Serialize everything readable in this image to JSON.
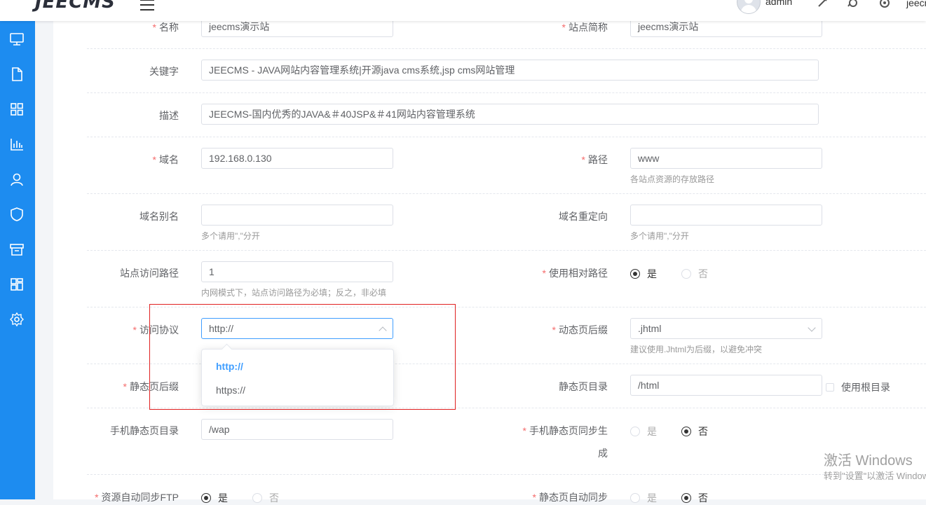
{
  "header": {
    "logo": "JEECMS",
    "user_name": "admin",
    "site_text": "jeecms演示站"
  },
  "sidebar": {
    "items": [
      {
        "icon": "monitor-icon"
      },
      {
        "icon": "document-icon"
      },
      {
        "icon": "grid-icon"
      },
      {
        "icon": "bar-chart-icon"
      },
      {
        "icon": "user-icon"
      },
      {
        "icon": "shield-icon"
      },
      {
        "icon": "archive-icon"
      },
      {
        "icon": "modules-icon"
      },
      {
        "icon": "gear-icon"
      }
    ]
  },
  "form": {
    "name": {
      "label": "名称",
      "value": "jeecms演示站"
    },
    "short_name": {
      "label": "站点简称",
      "value": "jeecms演示站"
    },
    "keywords": {
      "label": "关键字",
      "value": "JEECMS - JAVA网站内容管理系统|开源java cms系统,jsp cms网站管理"
    },
    "description": {
      "label": "描述",
      "value": "JEECMS-国内优秀的JAVA&＃40JSP&＃41网站内容管理系统"
    },
    "domain": {
      "label": "域名",
      "value": "192.168.0.130"
    },
    "path": {
      "label": "路径",
      "value": "www",
      "hint": "各站点资源的存放路径"
    },
    "domain_alias": {
      "label": "域名别名",
      "value": "",
      "hint": "多个请用\",\"分开"
    },
    "domain_redirect": {
      "label": "域名重定向",
      "value": "",
      "hint": "多个请用\",\"分开"
    },
    "site_path": {
      "label": "站点访问路径",
      "value": "1",
      "hint": "内网模式下，站点访问路径为必填；反之，非必填"
    },
    "relative_path": {
      "label": "使用相对路径",
      "yes": "是",
      "no": "否",
      "selected": "是"
    },
    "protocol": {
      "label": "访问协议",
      "value": "http://",
      "options": [
        "http://",
        "https://"
      ],
      "selected": "http://"
    },
    "dynamic_suffix": {
      "label": "动态页后缀",
      "value": ".jhtml",
      "hint": "建议使用.Jhtml为后缀，以避免冲突"
    },
    "static_suffix": {
      "label": "静态页后缀"
    },
    "static_dir": {
      "label": "静态页目录",
      "value": "/html",
      "checkbox_label": "使用根目录"
    },
    "mobile_static_dir": {
      "label": "手机静态页目录",
      "value": "/wap"
    },
    "mobile_static_sync": {
      "label_line1": "手机静态页同步生",
      "label_line2": "成",
      "yes": "是",
      "no": "否",
      "selected": "否"
    },
    "resource_ftp_sync": {
      "label": "资源自动同步FTP",
      "yes": "是",
      "no": "否",
      "selected": "是"
    },
    "static_auto_sync": {
      "label": "静态页自动同步",
      "yes": "是",
      "no": "否",
      "selected": "否"
    }
  },
  "watermark": {
    "line1": "激活 Windows",
    "line2": "转到\"设置\"以激活 Windows。"
  }
}
